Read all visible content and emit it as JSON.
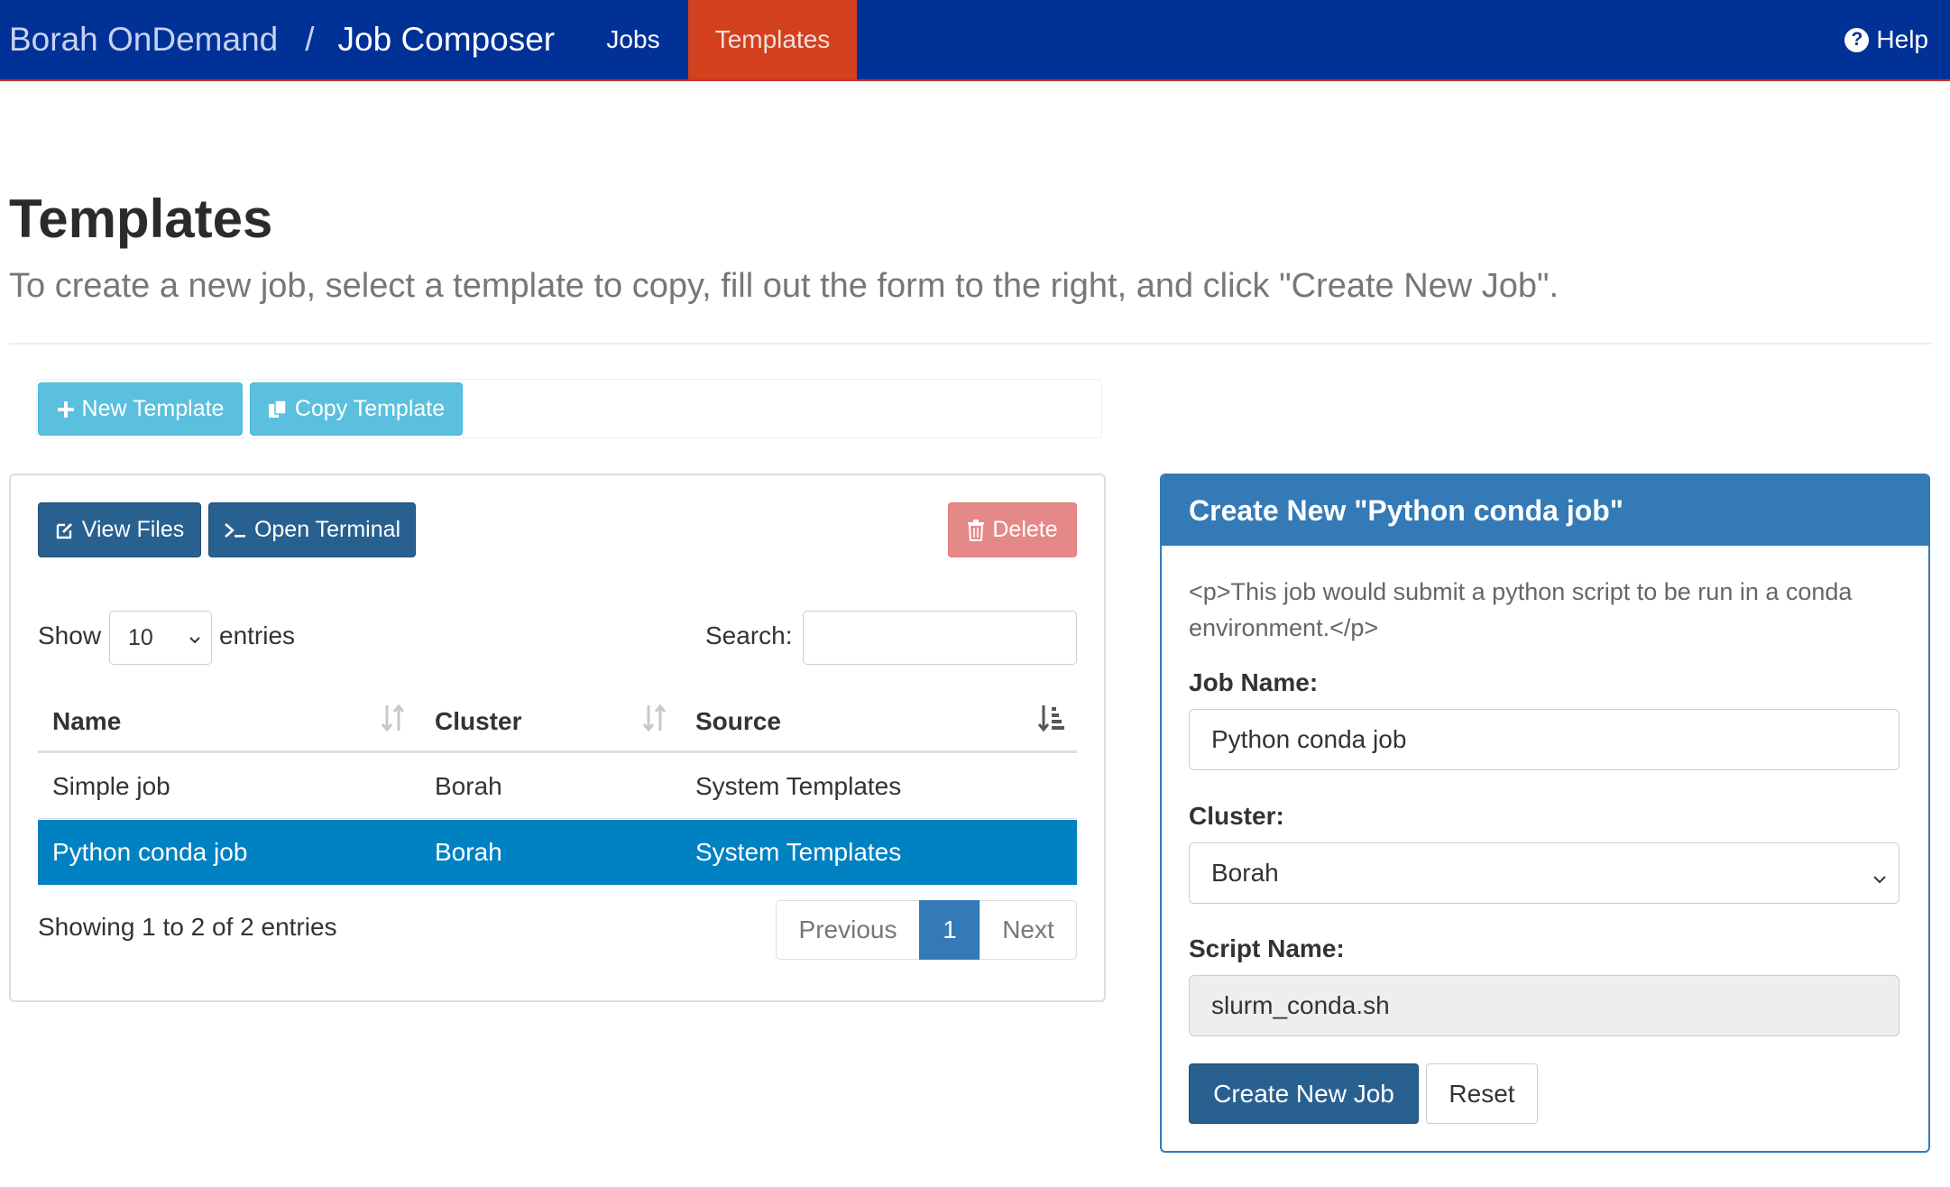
{
  "navbar": {
    "org": "Borah OnDemand",
    "separator": "/",
    "app": "Job Composer",
    "links": {
      "jobs": "Jobs",
      "templates": "Templates",
      "help": "Help"
    },
    "active": "Templates"
  },
  "page": {
    "title": "Templates",
    "subtitle": "To create a new job, select a template to copy, fill out the form to the right, and click \"Create New Job\"."
  },
  "toolbar": {
    "new_template": "New Template",
    "copy_template": "Copy Template"
  },
  "actions": {
    "view_files": "View Files",
    "open_terminal": "Open Terminal",
    "delete": "Delete"
  },
  "table_controls": {
    "show": "Show",
    "page_length": "10",
    "entries": "entries",
    "search_label": "Search:",
    "search_value": ""
  },
  "table": {
    "columns": [
      "Name",
      "Cluster",
      "Source"
    ],
    "rows": [
      {
        "name": "Simple job",
        "cluster": "Borah",
        "source": "System Templates",
        "selected": false
      },
      {
        "name": "Python conda job",
        "cluster": "Borah",
        "source": "System Templates",
        "selected": true
      }
    ],
    "info": "Showing 1 to 2 of 2 entries",
    "pagination": {
      "previous": "Previous",
      "current": "1",
      "next": "Next"
    }
  },
  "form": {
    "heading": "Create New \"Python conda job\"",
    "description": "<p>This job would submit a python script to be run in a conda environment.</p>",
    "job_name_label": "Job Name:",
    "job_name_value": "Python conda job",
    "cluster_label": "Cluster:",
    "cluster_value": "Borah",
    "script_name_label": "Script Name:",
    "script_name_value": "slurm_conda.sh",
    "create_button": "Create New Job",
    "reset_button": "Reset"
  },
  "colors": {
    "navbar": "#003197",
    "active_tab": "#d2401d",
    "primary": "#337ab7",
    "info": "#5bc0de",
    "selected_row": "#0081c2",
    "danger_disabled": "#e58888"
  }
}
